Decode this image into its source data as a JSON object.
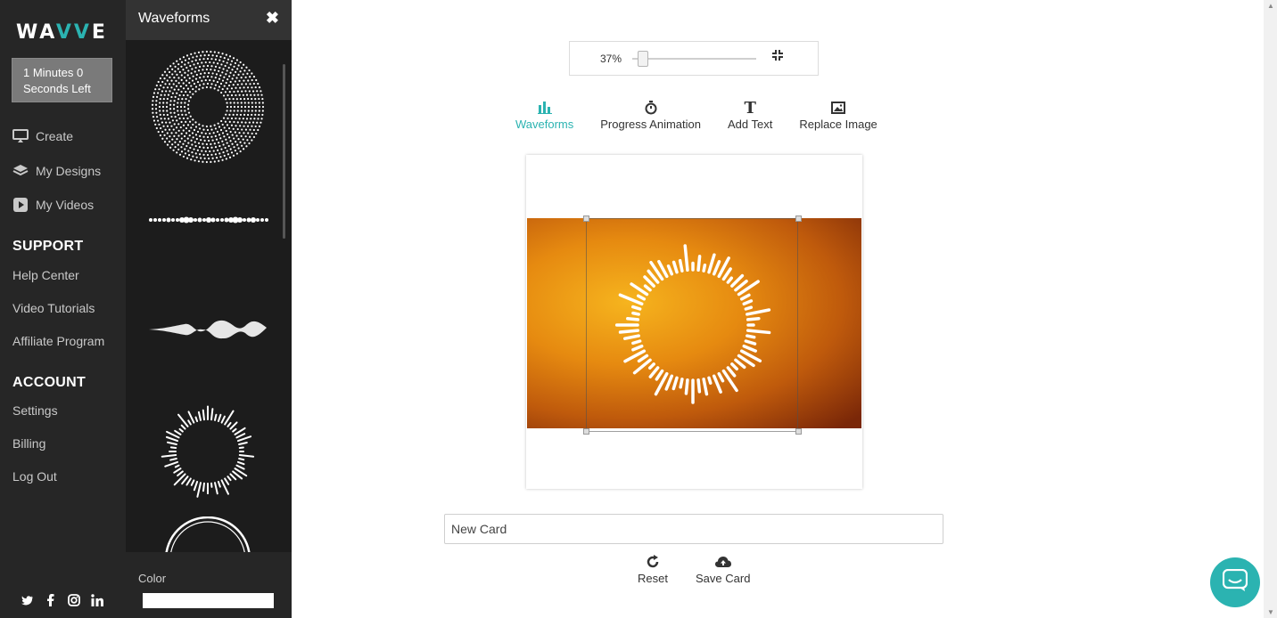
{
  "brand": {
    "logo_pre": "WA",
    "logo_mid": "VV",
    "logo_post": "E",
    "accent": "#2bb3b1"
  },
  "timer": {
    "line1": "1 Minutes 0",
    "line2": "Seconds Left"
  },
  "nav": [
    {
      "label": "Create",
      "icon": "monitor-icon"
    },
    {
      "label": "My Designs",
      "icon": "layers-icon"
    },
    {
      "label": "My Videos",
      "icon": "play-icon"
    }
  ],
  "support": {
    "heading": "SUPPORT",
    "links": [
      "Help Center",
      "Video Tutorials",
      "Affiliate Program"
    ]
  },
  "account": {
    "heading": "ACCOUNT",
    "links": [
      "Settings",
      "Billing",
      "Log Out"
    ]
  },
  "social": [
    "twitter-icon",
    "facebook-icon",
    "instagram-icon",
    "linkedin-icon"
  ],
  "panel": {
    "title": "Waveforms",
    "close": "✖",
    "color_label": "Color",
    "color_value": "#ffffff"
  },
  "zoom": {
    "value": "37%",
    "level": 0.37
  },
  "tabs": [
    {
      "label": "Waveforms",
      "icon": "bar-chart-icon",
      "active": true
    },
    {
      "label": "Progress Animation",
      "icon": "stopwatch-icon",
      "active": false
    },
    {
      "label": "Add Text",
      "icon": "text-icon",
      "active": false
    },
    {
      "label": "Replace Image",
      "icon": "image-icon",
      "active": false
    }
  ],
  "card": {
    "value": "New Card"
  },
  "actions": {
    "reset": "Reset",
    "save": "Save Card"
  }
}
